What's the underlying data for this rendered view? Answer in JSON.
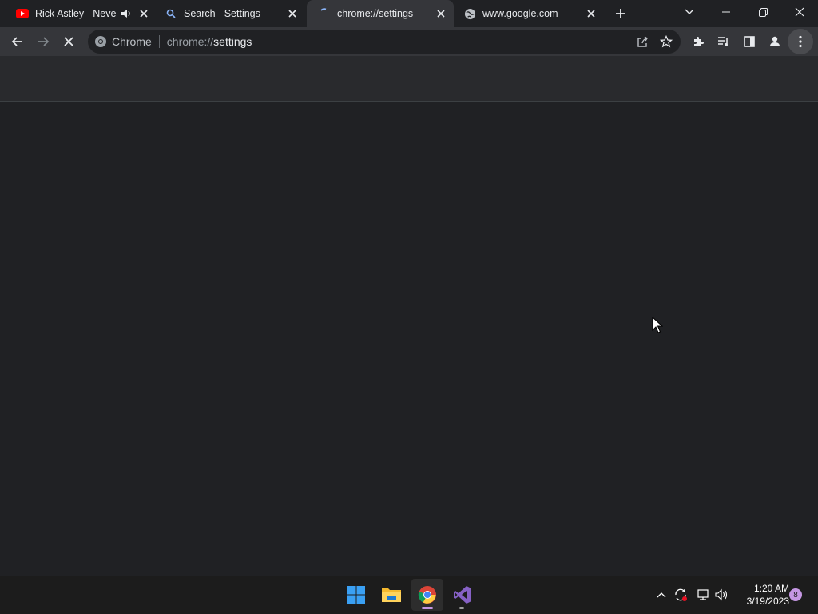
{
  "tabs": [
    {
      "title": "Rick Astley - Never Gonna Give You Up",
      "favicon": "youtube-icon",
      "audio": true
    },
    {
      "title": "Search - Settings",
      "favicon": "search-icon"
    },
    {
      "title": "chrome://settings",
      "favicon": "loading-spinner-icon",
      "active": true
    },
    {
      "title": "www.google.com",
      "favicon": "globe-icon"
    }
  ],
  "window_controls": [
    "tab-search-icon",
    "minimize-icon",
    "restore-icon",
    "close-icon"
  ],
  "toolbar": {
    "site_label": "Chrome",
    "url_scheme": "chrome://",
    "url_host": "settings"
  },
  "taskbar": {
    "apps": [
      "windows-start-icon",
      "file-explorer-icon",
      "chrome-icon",
      "visual-studio-icon"
    ],
    "time": "1:20 AM",
    "date": "3/19/2023",
    "notification_count": "8"
  },
  "colors": {
    "accent": "#8ab4f8",
    "youtube_red": "#ff0000",
    "taskbar_indicator": "#c597e3"
  }
}
